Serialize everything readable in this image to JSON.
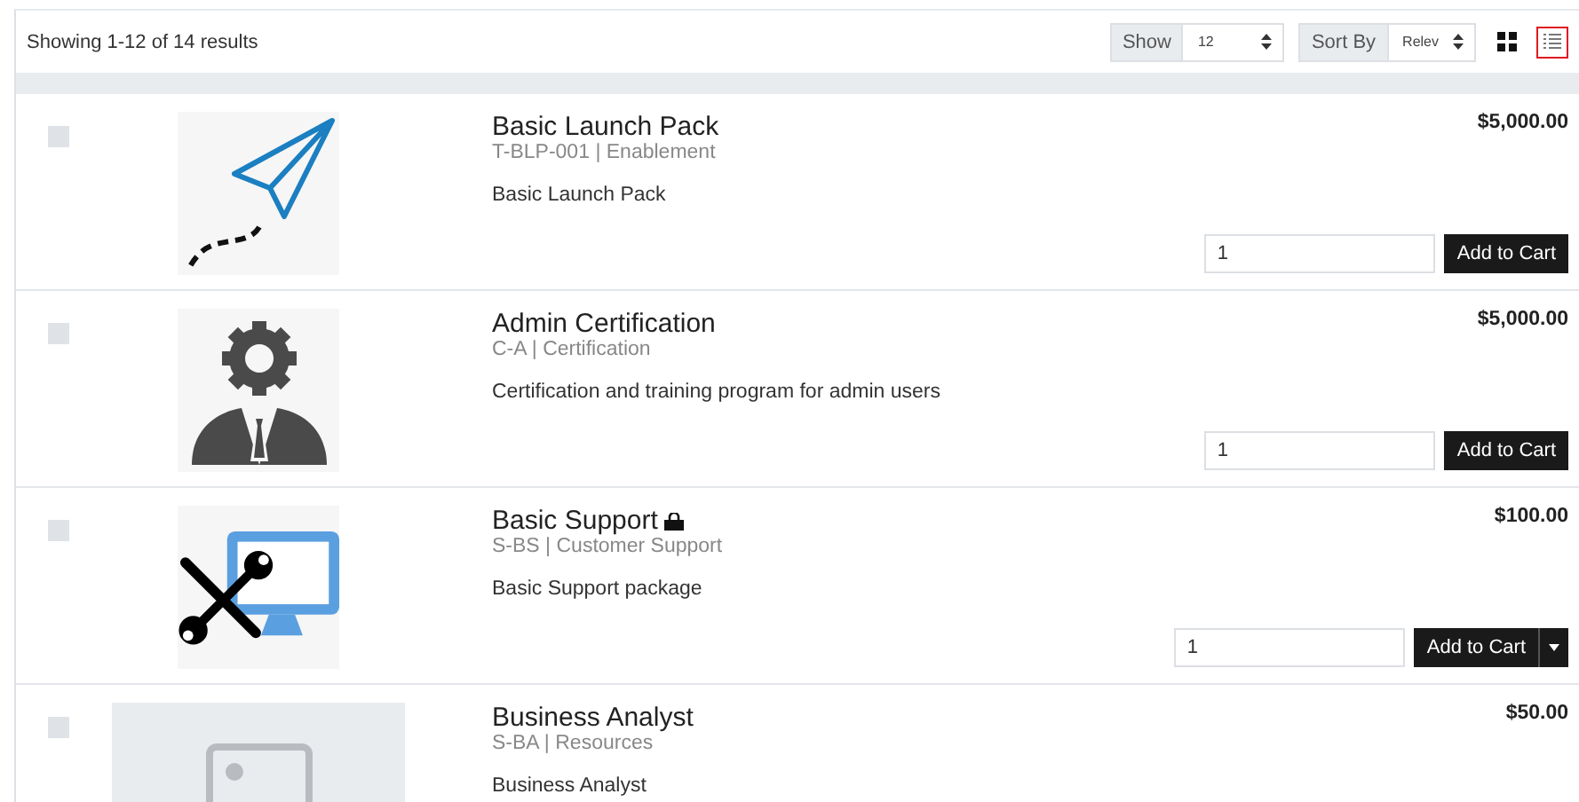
{
  "toolbar": {
    "results": "Showing 1-12 of 14 results",
    "show": {
      "label": "Show",
      "value": "12"
    },
    "sort": {
      "label": "Sort By",
      "value": "Relev"
    },
    "views": [
      {
        "kind": "grid",
        "selected": false
      },
      {
        "kind": "list",
        "selected": true
      }
    ]
  },
  "separator": "|",
  "products": [
    {
      "kind": "plane",
      "checked": false,
      "title": "Basic Launch Pack",
      "code": "T-BLP-001",
      "category": "Enablement",
      "description": "Basic Launch Pack",
      "price": "$5,000.00",
      "quantity": "1",
      "button": "Add to Cart",
      "bag": false,
      "options": false
    },
    {
      "kind": "person",
      "checked": false,
      "title": "Admin Certification",
      "code": "C-A",
      "category": "Certification",
      "description": "Certification and training program for admin users",
      "price": "$5,000.00",
      "quantity": "1",
      "button": "Add to Cart",
      "bag": false,
      "options": false
    },
    {
      "kind": "support",
      "checked": false,
      "title": "Basic Support",
      "code": "S-BS",
      "category": "Customer Support",
      "description": "Basic Support package",
      "price": "$100.00",
      "quantity": "1",
      "button": "Add to Cart",
      "bag": true,
      "options": true
    },
    {
      "kind": "placeholder",
      "checked": false,
      "title": "Business Analyst",
      "code": "S-BA",
      "category": "Resources",
      "description": "Business Analyst",
      "price": "$50.00",
      "bag": false,
      "options": false
    }
  ]
}
